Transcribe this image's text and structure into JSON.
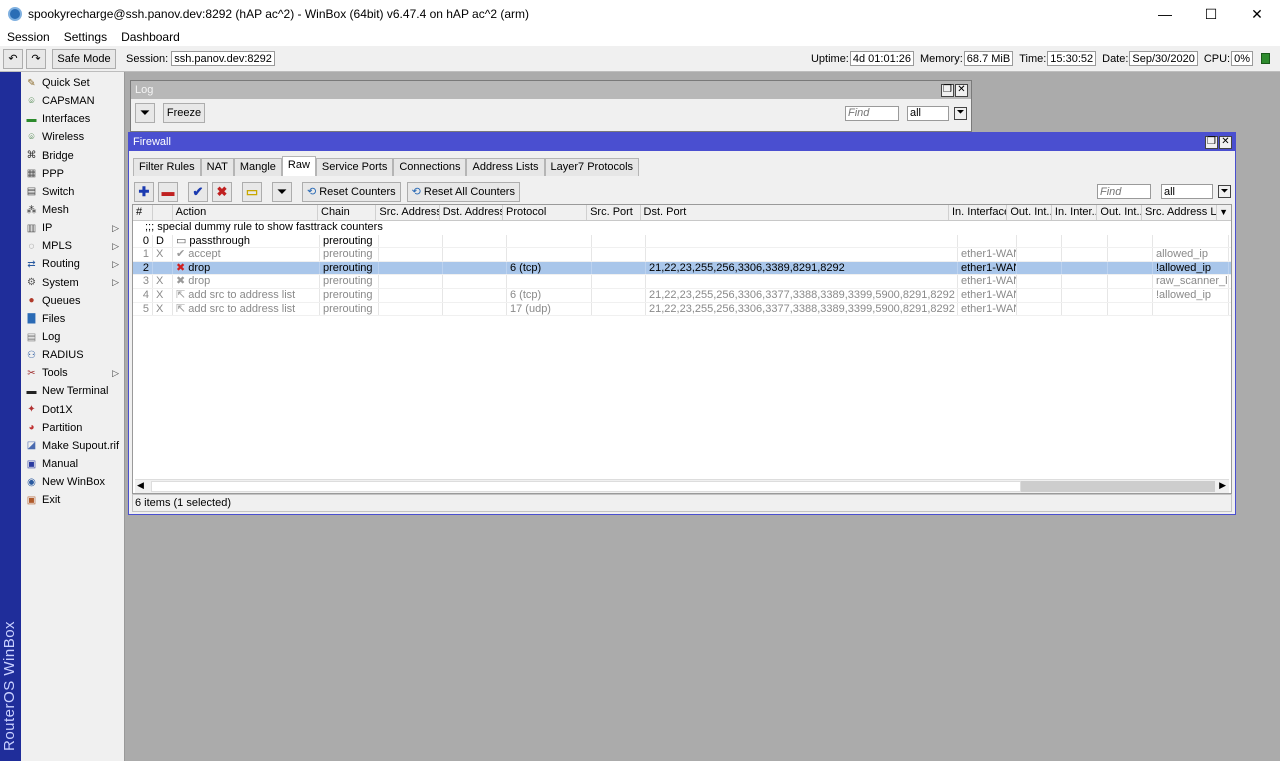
{
  "window": {
    "title": "spookyrecharge@ssh.panov.dev:8292 (hAP ac^2) - WinBox (64bit) v6.47.4 on hAP ac^2 (arm)",
    "minimize": "—",
    "maximize": "☐",
    "close": "✕"
  },
  "menubar": [
    "Session",
    "Settings",
    "Dashboard"
  ],
  "toolbar": {
    "undo": "↶",
    "redo": "↷",
    "safe_mode": "Safe Mode",
    "session_label": "Session:",
    "session_value": "ssh.panov.dev:8292",
    "uptime_label": "Uptime:",
    "uptime_value": "4d 01:01:26",
    "memory_label": "Memory:",
    "memory_value": "68.7 MiB",
    "time_label": "Time:",
    "time_value": "15:30:52",
    "date_label": "Date:",
    "date_value": "Sep/30/2020",
    "cpu_label": "CPU:",
    "cpu_value": "0%"
  },
  "sidebar": {
    "brand": "RouterOS WinBox",
    "items": [
      {
        "label": "Quick Set",
        "icon": "wand-icon",
        "glyph": "✎",
        "color": "#8a6a2a"
      },
      {
        "label": "CAPsMAN",
        "icon": "antenna-icon",
        "glyph": "⌾",
        "color": "#3a7a3a"
      },
      {
        "label": "Interfaces",
        "icon": "interfaces-icon",
        "glyph": "▬",
        "color": "#2c8a2c"
      },
      {
        "label": "Wireless",
        "icon": "wireless-icon",
        "glyph": "⌾",
        "color": "#3a7a3a"
      },
      {
        "label": "Bridge",
        "icon": "bridge-icon",
        "glyph": "⌘",
        "color": "#333"
      },
      {
        "label": "PPP",
        "icon": "ppp-icon",
        "glyph": "▦",
        "color": "#555"
      },
      {
        "label": "Switch",
        "icon": "switch-icon",
        "glyph": "▤",
        "color": "#444"
      },
      {
        "label": "Mesh",
        "icon": "mesh-icon",
        "glyph": "⁂",
        "color": "#333"
      },
      {
        "label": "IP",
        "icon": "ip-icon",
        "glyph": "▥",
        "color": "#555",
        "submenu": true
      },
      {
        "label": "MPLS",
        "icon": "mpls-icon",
        "glyph": "◌",
        "color": "#666",
        "submenu": true
      },
      {
        "label": "Routing",
        "icon": "routing-icon",
        "glyph": "⇄",
        "color": "#2a5aa0",
        "submenu": true
      },
      {
        "label": "System",
        "icon": "system-icon",
        "glyph": "⚙",
        "color": "#555",
        "submenu": true
      },
      {
        "label": "Queues",
        "icon": "queues-icon",
        "glyph": "●",
        "color": "#b03a2a"
      },
      {
        "label": "Files",
        "icon": "files-icon",
        "glyph": "▇",
        "color": "#2a6ab5"
      },
      {
        "label": "Log",
        "icon": "log-icon",
        "glyph": "▤",
        "color": "#777"
      },
      {
        "label": "RADIUS",
        "icon": "radius-icon",
        "glyph": "⚇",
        "color": "#2a5aa0"
      },
      {
        "label": "Tools",
        "icon": "tools-icon",
        "glyph": "✂",
        "color": "#a03030",
        "submenu": true
      },
      {
        "label": "New Terminal",
        "icon": "terminal-icon",
        "glyph": "▬",
        "color": "#222"
      },
      {
        "label": "Dot1X",
        "icon": "dot1x-icon",
        "glyph": "✦",
        "color": "#b03030"
      },
      {
        "label": "Partition",
        "icon": "partition-icon",
        "glyph": "◕",
        "color": "#c03030"
      },
      {
        "label": "Make Supout.rif",
        "icon": "supout-icon",
        "glyph": "◪",
        "color": "#4a6ab0"
      },
      {
        "label": "Manual",
        "icon": "manual-icon",
        "glyph": "▣",
        "color": "#2a3aa0"
      },
      {
        "label": "New WinBox",
        "icon": "winbox-icon",
        "glyph": "◉",
        "color": "#2a5aa0"
      },
      {
        "label": "Exit",
        "icon": "exit-icon",
        "glyph": "▣",
        "color": "#b05a2a"
      }
    ]
  },
  "log_window": {
    "title": "Log",
    "freeze": "Freeze",
    "find_placeholder": "Find",
    "filter_value": "all"
  },
  "firewall": {
    "title": "Firewall",
    "tabs": [
      "Filter Rules",
      "NAT",
      "Mangle",
      "Raw",
      "Service Ports",
      "Connections",
      "Address Lists",
      "Layer7 Protocols"
    ],
    "active_tab": "Raw",
    "reset_counters": "Reset Counters",
    "reset_all_counters": "Reset All Counters",
    "find_placeholder": "Find",
    "filter_value": "all",
    "columns": [
      "#",
      "",
      "Action",
      "Chain",
      "Src. Address",
      "Dst. Address",
      "Protocol",
      "Src. Port",
      "Dst. Port",
      "In. Interface",
      "Out. Int...",
      "In. Inter...",
      "Out. Int...",
      "Src. Address L"
    ],
    "comment": ";;; special dummy rule to show fasttrack counters",
    "rows": [
      {
        "num": "0",
        "flag": "D",
        "action": "passthrough",
        "action_icon": "passthrough-icon",
        "glyph": "▭",
        "glyph_color": "#555",
        "chain": "prerouting",
        "src": "",
        "dst": "",
        "protocol": "",
        "sport": "",
        "dport": "",
        "in_if": "",
        "out_if": "",
        "in_list": "",
        "out_list": "",
        "src_list": "",
        "state": "normal"
      },
      {
        "num": "1",
        "flag": "X",
        "action": "accept",
        "action_icon": "accept-icon",
        "glyph": "✔",
        "glyph_color": "#9a9a9a",
        "chain": "prerouting",
        "src": "",
        "dst": "",
        "protocol": "",
        "sport": "",
        "dport": "",
        "in_if": "ether1-WAN",
        "out_if": "",
        "in_list": "",
        "out_list": "",
        "src_list": "allowed_ip",
        "state": "disabled"
      },
      {
        "num": "2",
        "flag": "",
        "action": "drop",
        "action_icon": "drop-icon",
        "glyph": "✖",
        "glyph_color": "#d02020",
        "chain": "prerouting",
        "src": "",
        "dst": "",
        "protocol": "6 (tcp)",
        "sport": "",
        "dport": "21,22,23,255,256,3306,3389,8291,8292",
        "in_if": "ether1-WAN",
        "out_if": "",
        "in_list": "",
        "out_list": "",
        "src_list": "!allowed_ip",
        "state": "selected"
      },
      {
        "num": "3",
        "flag": "X",
        "action": "drop",
        "action_icon": "drop-icon",
        "glyph": "✖",
        "glyph_color": "#9a9a9a",
        "chain": "prerouting",
        "src": "",
        "dst": "",
        "protocol": "",
        "sport": "",
        "dport": "",
        "in_if": "ether1-WAN",
        "out_if": "",
        "in_list": "",
        "out_list": "",
        "src_list": "raw_scanner_list",
        "state": "disabled"
      },
      {
        "num": "4",
        "flag": "X",
        "action": "add src to address list",
        "action_icon": "add-list-icon",
        "glyph": "⇱",
        "glyph_color": "#9a9a9a",
        "chain": "prerouting",
        "src": "",
        "dst": "",
        "protocol": "6 (tcp)",
        "sport": "",
        "dport": "21,22,23,255,256,3306,3377,3388,3389,3399,5900,8291,8292",
        "in_if": "ether1-WAN",
        "out_if": "",
        "in_list": "",
        "out_list": "",
        "src_list": "!allowed_ip",
        "state": "disabled"
      },
      {
        "num": "5",
        "flag": "X",
        "action": "add src to address list",
        "action_icon": "add-list-icon",
        "glyph": "⇱",
        "glyph_color": "#9a9a9a",
        "chain": "prerouting",
        "src": "",
        "dst": "",
        "protocol": "17 (udp)",
        "sport": "",
        "dport": "21,22,23,255,256,3306,3377,3388,3389,3399,5900,8291,8292",
        "in_if": "ether1-WAN",
        "out_if": "",
        "in_list": "",
        "out_list": "",
        "src_list": "",
        "state": "disabled"
      }
    ],
    "status": "6 items (1 selected)"
  },
  "colors": {
    "titlebar_active": "#4a4fd0",
    "titlebar_inactive": "#b8b8b8",
    "selection": "#a9c6ea",
    "sidebar_strip": "#1f2d9a"
  }
}
